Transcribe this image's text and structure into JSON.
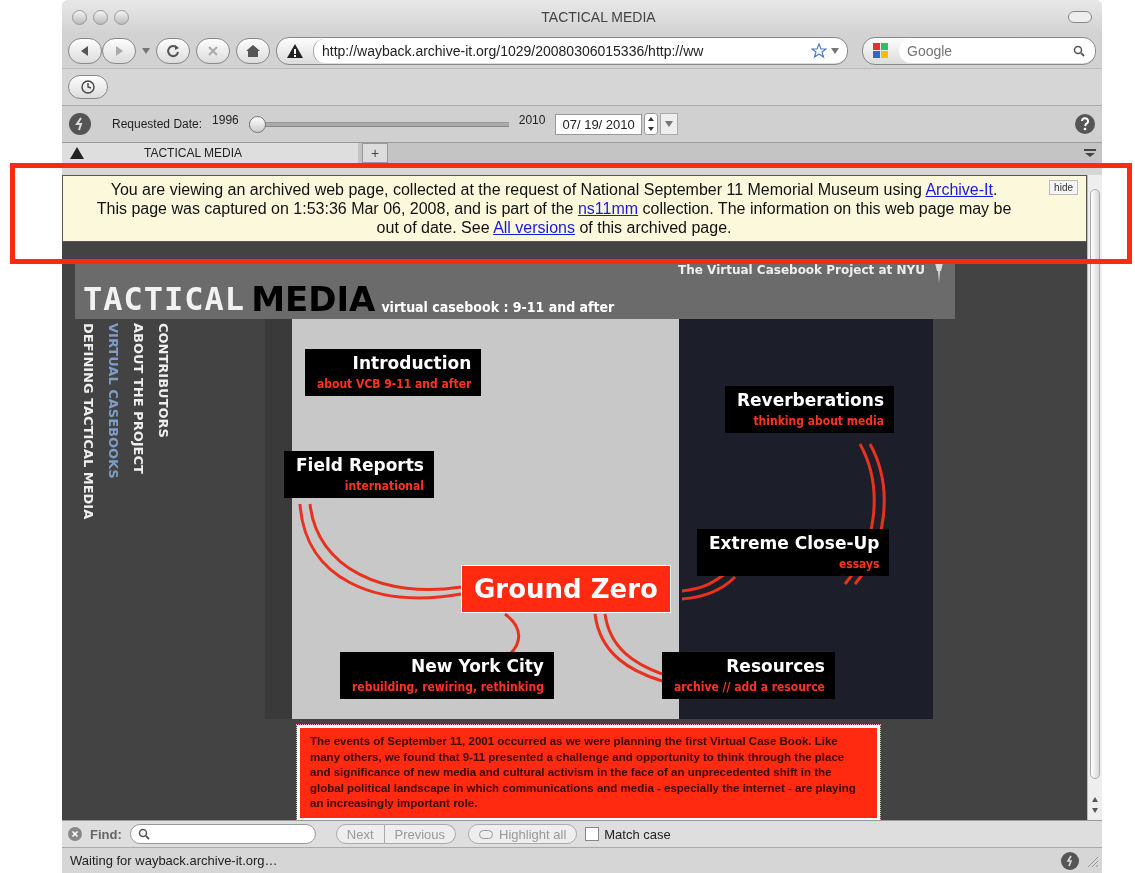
{
  "window": {
    "title": "TACTICAL MEDIA"
  },
  "toolbar": {
    "url": "http://wayback.archive-it.org/1029/20080306015336/http://ww",
    "search_placeholder": "Google"
  },
  "wayback_bar": {
    "label": "Requested Date:",
    "start_year": "1996",
    "end_year": "2010",
    "slider": {
      "level": 0
    },
    "date": "07/ 19/ 2010"
  },
  "tabs": [
    {
      "label": "TACTICAL MEDIA",
      "selected": true
    }
  ],
  "new_tab": "+",
  "notice": {
    "segments": [
      {
        "kind": "text",
        "text": "You are viewing an archived web page, collected at the request of National September 11 Memorial Museum using "
      },
      {
        "kind": "link",
        "text": "Archive-It"
      },
      {
        "kind": "text",
        "text": ". This page was captured on 1:53:36 Mar 06, 2008, and is part of the "
      },
      {
        "kind": "link",
        "text": "ns11mm"
      },
      {
        "kind": "text",
        "text": " collection. The information on this web page may be out of date. See "
      },
      {
        "kind": "link",
        "text": "All versions"
      },
      {
        "kind": "text",
        "text": " of this archived page."
      }
    ],
    "hide_button": "hide"
  },
  "site": {
    "logo_dotted": "TACTICAL",
    "logo_bold": "MEDIA",
    "tagline": "virtual casebook : 9-11 and after",
    "project": "The Virtual Casebook Project at NYU",
    "nav": [
      {
        "label": "DEFINING TACTICAL MEDIA",
        "selected": false
      },
      {
        "label": "VIRTUAL CASEBOOKS",
        "selected": true
      },
      {
        "label": "ABOUT THE PROJECT",
        "selected": false
      },
      {
        "label": "CONTRIBUTORS",
        "selected": false
      }
    ],
    "sections": [
      {
        "kind": "plain",
        "title": "Introduction",
        "subtitle": "about VCB 9-11 and after"
      },
      {
        "kind": "plain",
        "title": "Reverberations",
        "subtitle": "thinking about media"
      },
      {
        "kind": "plain",
        "title": "Field Reports",
        "subtitle": "international"
      },
      {
        "kind": "plain",
        "title": "Extreme Close-Up",
        "subtitle": "essays"
      },
      {
        "kind": "featured",
        "title": "Ground Zero"
      },
      {
        "kind": "plain",
        "title": "New York City",
        "subtitle": "rebuilding, rewiring, rethinking"
      },
      {
        "kind": "plain",
        "title": "Resources",
        "subtitle": "archive // add a resource"
      }
    ],
    "intro_text": "The events of September 11, 2001 occurred as we were planning the first Virtual Case Book. Like many others, we found that 9-11 presented a challenge and opportunity to think through the place and significance of new media and cultural activism in the face of an unprecedented shift in the global political landscape in which communications and media - especially the internet - are playing an increasingly important role."
  },
  "find_bar": {
    "label": "Find:",
    "next": "Next",
    "previous": "Previous",
    "highlight": "Highlight all",
    "match_case": {
      "label": "Match case",
      "checked": false
    }
  },
  "status_bar": {
    "text": "Waiting for wayback.archive-it.org…"
  }
}
